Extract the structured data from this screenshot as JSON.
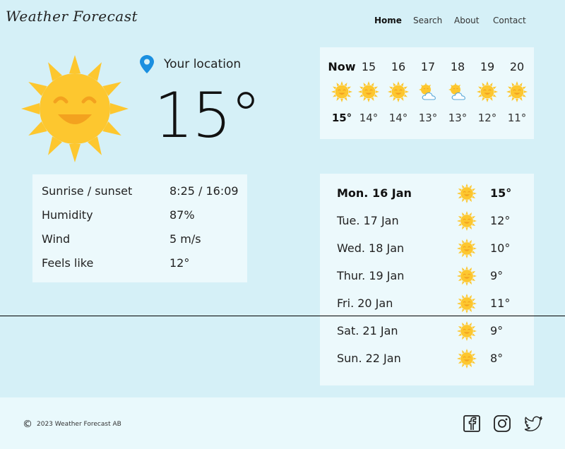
{
  "header": {
    "logo": "Weather Forecast",
    "nav": [
      {
        "label": "Home",
        "active": true
      },
      {
        "label": "Search",
        "active": false
      },
      {
        "label": "About",
        "active": false
      },
      {
        "label": "Contact",
        "active": false
      }
    ]
  },
  "current": {
    "icon": "sun-smiling-icon",
    "location_icon": "map-pin-icon",
    "location": "Your location",
    "temperature": "15°"
  },
  "details": [
    {
      "label": "Sunrise / sunset",
      "value": "8:25 / 16:09"
    },
    {
      "label": "Humidity",
      "value": "87%"
    },
    {
      "label": "Wind",
      "value": "5 m/s"
    },
    {
      "label": "Feels like",
      "value": "12°"
    }
  ],
  "hourly": [
    {
      "time": "Now",
      "icon": "sun-icon",
      "temp": "15°"
    },
    {
      "time": "15",
      "icon": "sun-icon",
      "temp": "14°"
    },
    {
      "time": "16",
      "icon": "sun-icon",
      "temp": "14°"
    },
    {
      "time": "17",
      "icon": "partly-cloudy-icon",
      "temp": "13°"
    },
    {
      "time": "18",
      "icon": "partly-cloudy-icon",
      "temp": "13°"
    },
    {
      "time": "19",
      "icon": "sun-icon",
      "temp": "12°"
    },
    {
      "time": "20",
      "icon": "sun-icon",
      "temp": "11°"
    }
  ],
  "daily": [
    {
      "day": "Mon. 16 Jan",
      "icon": "sun-icon",
      "temp": "15°"
    },
    {
      "day": "Tue. 17 Jan",
      "icon": "sun-icon",
      "temp": "12°"
    },
    {
      "day": "Wed. 18 Jan",
      "icon": "sun-icon",
      "temp": "10°"
    },
    {
      "day": "Thur. 19 Jan",
      "icon": "sun-icon",
      "temp": "9°"
    },
    {
      "day": "Fri. 20 Jan",
      "icon": "sun-icon",
      "temp": "11°"
    },
    {
      "day": "Sat. 21 Jan",
      "icon": "sun-icon",
      "temp": "9°"
    },
    {
      "day": "Sun. 22 Jan",
      "icon": "sun-icon",
      "temp": "8°"
    }
  ],
  "footer": {
    "copyright_symbol": "©",
    "copyright": "2023 Weather Forecast AB",
    "social": [
      "facebook-icon",
      "instagram-icon",
      "twitter-icon"
    ]
  },
  "colors": {
    "background": "#d5f0f7",
    "card": "#ecf9fc",
    "sun": "#fdc72f",
    "sun_face": "#f3a21f",
    "pin": "#1a8fe0"
  }
}
